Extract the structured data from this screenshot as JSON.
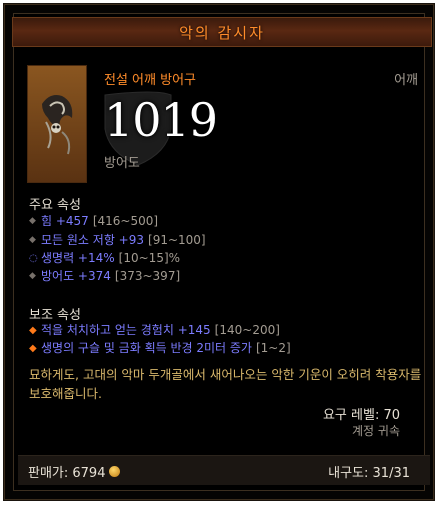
{
  "item": {
    "name": "악의 감시자",
    "type": "전설 어깨 방어구",
    "slot": "어깨",
    "armor_value": "1019",
    "armor_label": "방어도"
  },
  "primary": {
    "title": "주요 속성",
    "stats": [
      {
        "text": "힘 +457",
        "range": "[416~500]",
        "bullet": "diamond-gray"
      },
      {
        "text": "모든 원소 저항 +93",
        "range": "[91~100]",
        "bullet": "diamond-gray"
      },
      {
        "text": "생명력 +14%",
        "range": "[10~15]%",
        "bullet": "circle-blue"
      },
      {
        "text": "방어도 +374",
        "range": "[373~397]",
        "bullet": "diamond-gray"
      }
    ]
  },
  "secondary": {
    "title": "보조 속성",
    "stats": [
      {
        "text": "적을 처치하고 얻는 경험치 +145",
        "range": "[140~200]",
        "bullet": "diamond-orange"
      },
      {
        "text": "생명의 구슬 및 금화 획득 반경 2미터 증가",
        "range": "[1~2]",
        "bullet": "diamond-orange"
      }
    ]
  },
  "flavor": "묘하게도, 고대의 악마 두개골에서 새어나오는 악한 기운이 오히려 착용자를 보호해줍니다.",
  "requirements": {
    "level": "요구 레벨: 70",
    "binding": "계정 귀속"
  },
  "footer": {
    "price_label": "판매가: 6794",
    "durability": "내구도: 31/31"
  },
  "colors": {
    "legendary": "#ff8c2a",
    "magic": "#7c7cff",
    "gold_text": "#d9b86c",
    "muted": "#a39c92"
  }
}
